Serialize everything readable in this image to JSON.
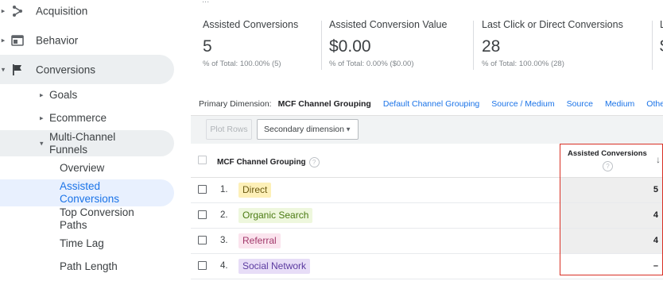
{
  "sidebar": {
    "items": [
      {
        "label": "Acquisition",
        "icon": "acquisition-icon",
        "caret": "▸"
      },
      {
        "label": "Behavior",
        "icon": "behavior-icon",
        "caret": "▸"
      },
      {
        "label": "Conversions",
        "icon": "flag-icon",
        "caret": "▾"
      }
    ],
    "sub_items": [
      {
        "label": "Goals",
        "caret": "▸"
      },
      {
        "label": "Ecommerce",
        "caret": "▸"
      },
      {
        "label": "Multi-Channel Funnels",
        "caret": "▾"
      }
    ],
    "leaf_items": [
      {
        "label": "Overview"
      },
      {
        "label": "Assisted Conversions"
      },
      {
        "label": "Top Conversion Paths"
      },
      {
        "label": "Time Lag"
      },
      {
        "label": "Path Length"
      }
    ]
  },
  "main": {
    "top_ellipsis": "...",
    "metrics": [
      {
        "title": "Assisted Conversions",
        "value": "5",
        "sub": "% of Total: 100.00% (5)"
      },
      {
        "title": "Assisted Conversion Value",
        "value": "$0.00",
        "sub": "% of Total: 0.00% ($0.00)"
      },
      {
        "title": "Last Click or Direct Conversions",
        "value": "28",
        "sub": "% of Total: 100.00% (28)"
      },
      {
        "title": "L",
        "value": "$",
        "sub": ""
      }
    ],
    "primary_dimension": {
      "label": "Primary Dimension:",
      "active": "MCF Channel Grouping",
      "links": [
        "Default Channel Grouping",
        "Source / Medium",
        "Source",
        "Medium"
      ],
      "other": "Other"
    },
    "toolbar": {
      "plot_rows": "Plot Rows",
      "secondary_dimension": "Secondary dimension"
    },
    "table": {
      "col_name": "MCF Channel Grouping",
      "col_metric": "Assisted Conversions",
      "help": "?",
      "sort_glyph": "↓",
      "rows": [
        {
          "index": "1.",
          "name": "Direct",
          "value": "5",
          "chip_bg": "#fdf0b8",
          "chip_fg": "#6b5a12"
        },
        {
          "index": "2.",
          "name": "Organic Search",
          "value": "4",
          "chip_bg": "#eef7dd",
          "chip_fg": "#4a7a12"
        },
        {
          "index": "3.",
          "name": "Referral",
          "value": "4",
          "chip_bg": "#fbe4ee",
          "chip_fg": "#a1386a"
        },
        {
          "index": "4.",
          "name": "Social Network",
          "value": "–",
          "chip_bg": "#e7ddf7",
          "chip_fg": "#5b3aa0"
        }
      ]
    }
  },
  "colors": {
    "accent": "#1a73e8",
    "highlight_border": "#d93025",
    "sidebar_active": "#eceff1",
    "sidebar_selected": "#e8f0fe"
  }
}
